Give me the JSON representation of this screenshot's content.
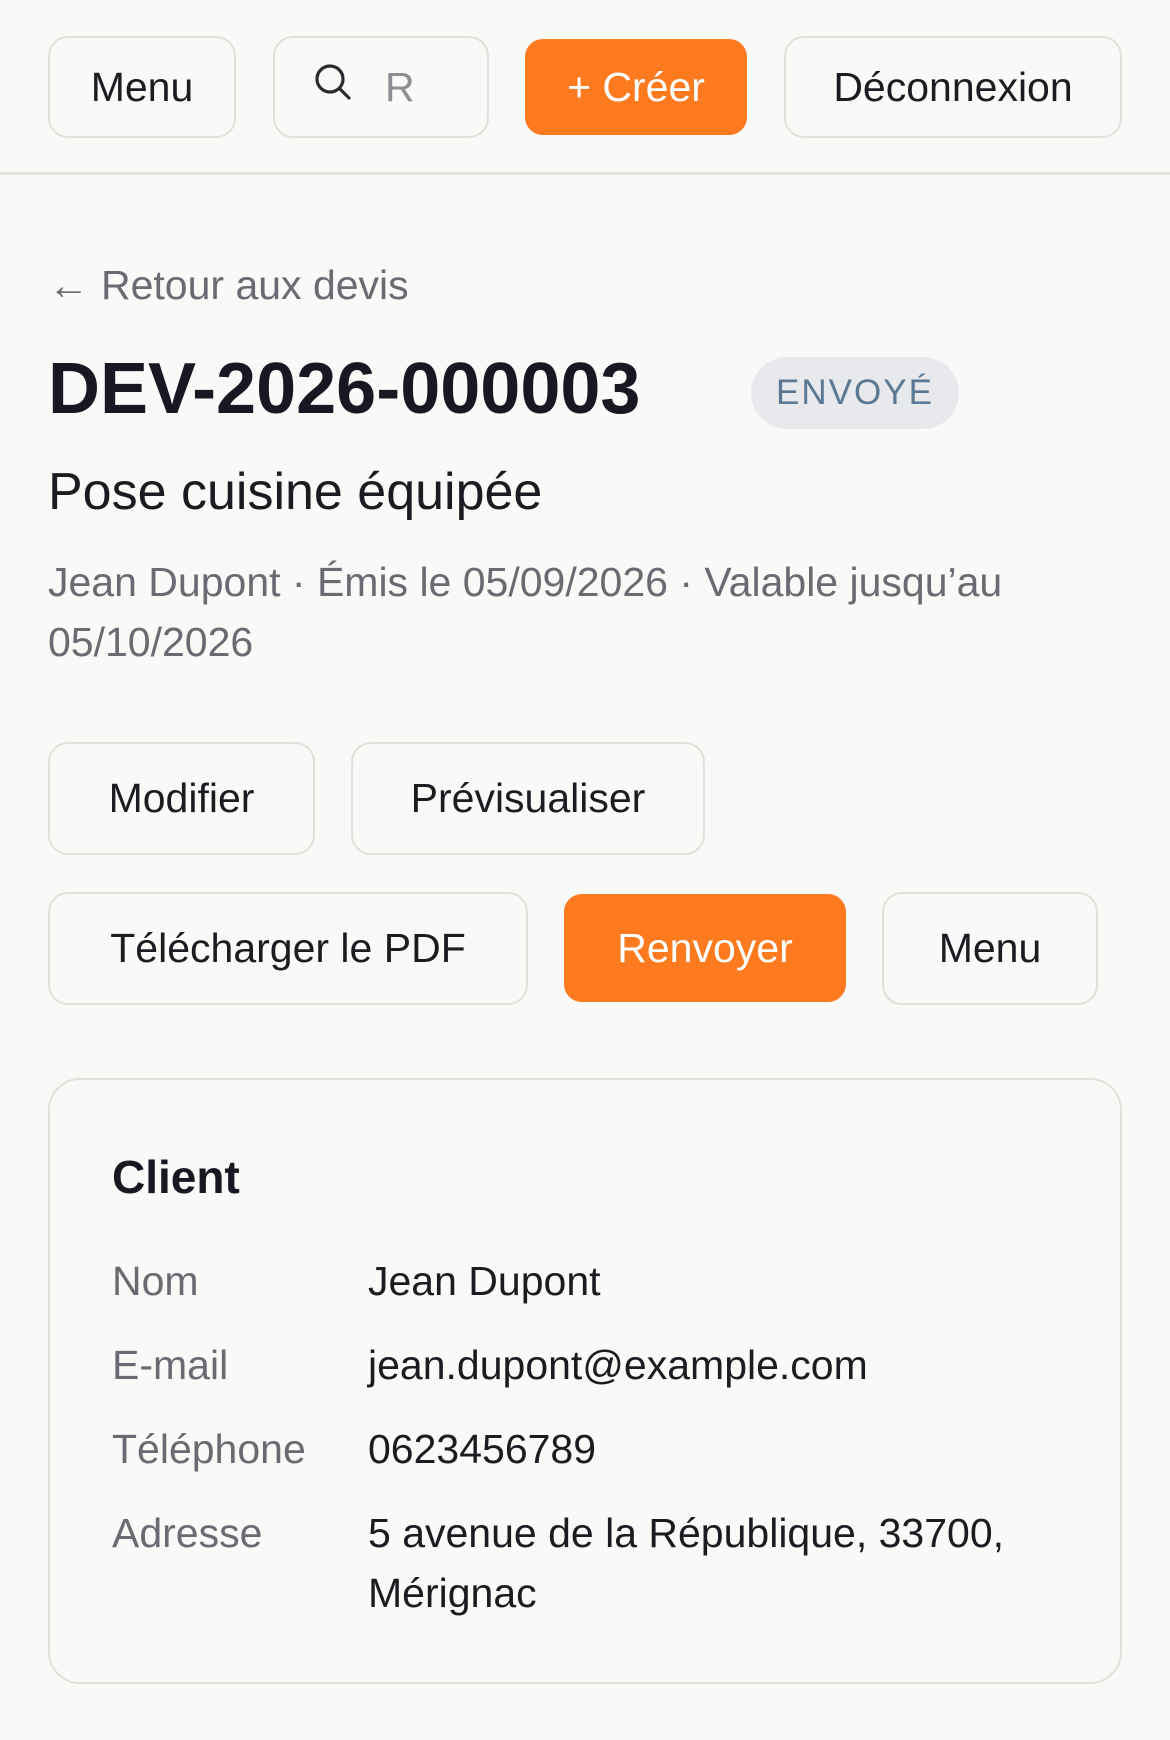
{
  "header": {
    "menu_label": "Menu",
    "search_placeholder": "R",
    "search_icon": "search-icon",
    "create_label": "+ Créer",
    "logout_label": "Déconnexion"
  },
  "back_link": {
    "arrow": "←",
    "label": "Retour aux devis"
  },
  "quote": {
    "number": "DEV-2026-000003",
    "status": "ENVOYÉ",
    "title": "Pose cuisine équipée",
    "meta": "Jean Dupont · Émis le 05/09/2026 · Valable jusqu’au 05/10/2026"
  },
  "actions": {
    "edit": "Modifier",
    "preview": "Prévisualiser",
    "download_pdf": "Télécharger le PDF",
    "resend": "Renvoyer",
    "menu": "Menu"
  },
  "client_card": {
    "title": "Client",
    "rows": [
      {
        "label": "Nom",
        "value": "Jean Dupont"
      },
      {
        "label": "E-mail",
        "value": "jean.dupont@example.com"
      },
      {
        "label": "Téléphone",
        "value": "0623456789"
      },
      {
        "label": "Adresse",
        "value": "5 avenue de la République, 33700, Mérignac"
      }
    ]
  },
  "colors": {
    "accent": "#fe7a1f",
    "background": "#f9f9f7",
    "badge_bg": "#e7e9ec",
    "badge_text": "#5d7892"
  }
}
